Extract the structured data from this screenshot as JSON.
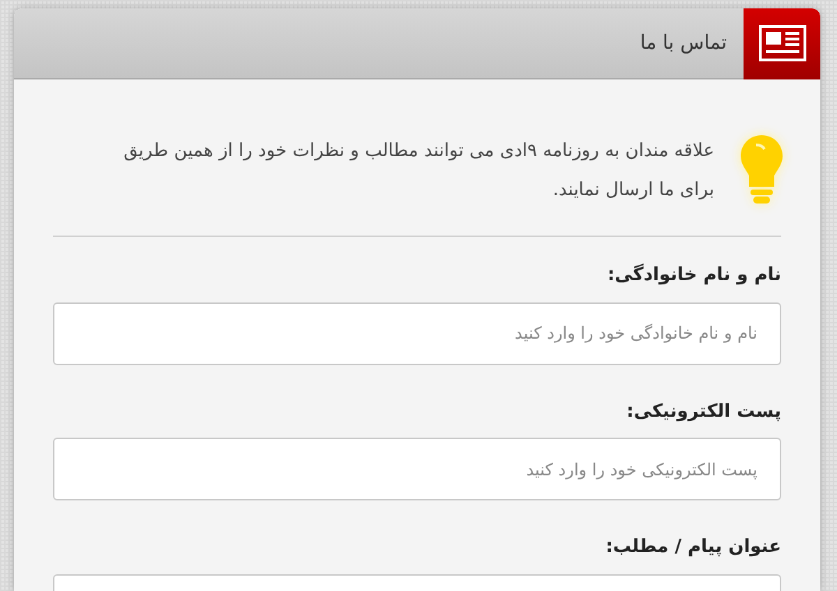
{
  "panel": {
    "title": "تماس با ما"
  },
  "intro": {
    "text": "علاقه مندان به روزنامه ۹ادی می توانند مطالب و نظرات خود را از همین طریق برای ما ارسال نمایند."
  },
  "fields": [
    {
      "label": "نام و نام خانوادگی:",
      "placeholder": "نام و نام خانوادگی خود را وارد کنید"
    },
    {
      "label": "پست الکترونیکی:",
      "placeholder": "پست الکترونیکی خود را وارد کنید"
    },
    {
      "label": "عنوان پیام / مطلب:"
    }
  ]
}
